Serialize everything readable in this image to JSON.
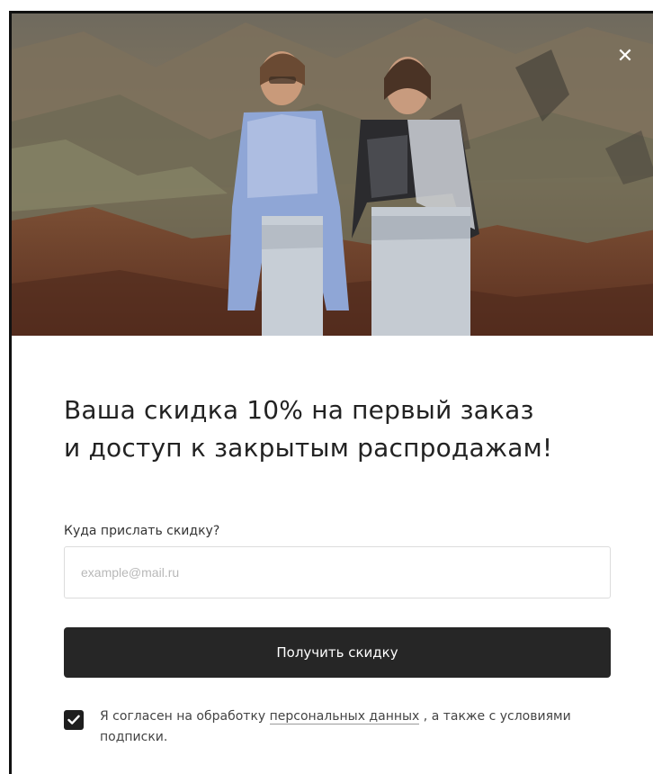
{
  "modal": {
    "close_icon": "close-icon",
    "headline_line1": "Ваша скидка 10% на первый заказ",
    "headline_line2": "и доступ к закрытым распродажам!",
    "subheading": "Куда прислать скидку?",
    "email": {
      "value": "",
      "placeholder": "example@mail.ru"
    },
    "cta_label": "Получить скидку",
    "consent": {
      "checked": true,
      "text_before": "Я согласен на обработку ",
      "link_text": "персональных данных",
      "text_after": " , а также с условиями подписки."
    }
  },
  "colors": {
    "button_bg": "#262626",
    "checkbox_bg": "#1e1e1e",
    "headline": "#222222"
  }
}
